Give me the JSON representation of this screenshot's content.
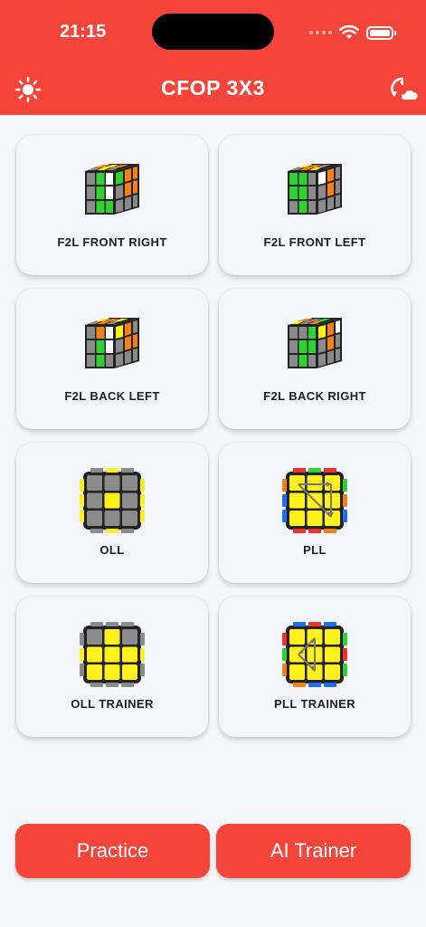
{
  "status_bar": {
    "time": "21:15"
  },
  "header": {
    "title": "CFOP 3X3",
    "left_icon": "sun-icon",
    "right_icon": "sync-icon"
  },
  "cards": [
    {
      "label": "F2L FRONT RIGHT",
      "icon": "cube-f2l-front-right-icon"
    },
    {
      "label": "F2L FRONT LEFT",
      "icon": "cube-f2l-front-left-icon"
    },
    {
      "label": "F2L BACK LEFT",
      "icon": "cube-f2l-back-left-icon"
    },
    {
      "label": "F2L BACK RIGHT",
      "icon": "cube-f2l-back-right-icon"
    },
    {
      "label": "OLL",
      "icon": "cube-oll-icon"
    },
    {
      "label": "PLL",
      "icon": "cube-pll-icon"
    },
    {
      "label": "OLL TRAINER",
      "icon": "cube-oll-trainer-icon"
    },
    {
      "label": "PLL TRAINER",
      "icon": "cube-pll-trainer-icon"
    }
  ],
  "buttons": {
    "practice": "Practice",
    "ai_trainer": "AI Trainer"
  },
  "colors": {
    "accent": "#f5443a",
    "background": "#f5f6fa",
    "cube_gray": "#8a8a8a",
    "green": "#2fd32f",
    "orange": "#f77f1a",
    "yellow": "#ffef1a",
    "red": "#f0312b",
    "blue": "#1c6ef2",
    "white": "#ffffff"
  }
}
